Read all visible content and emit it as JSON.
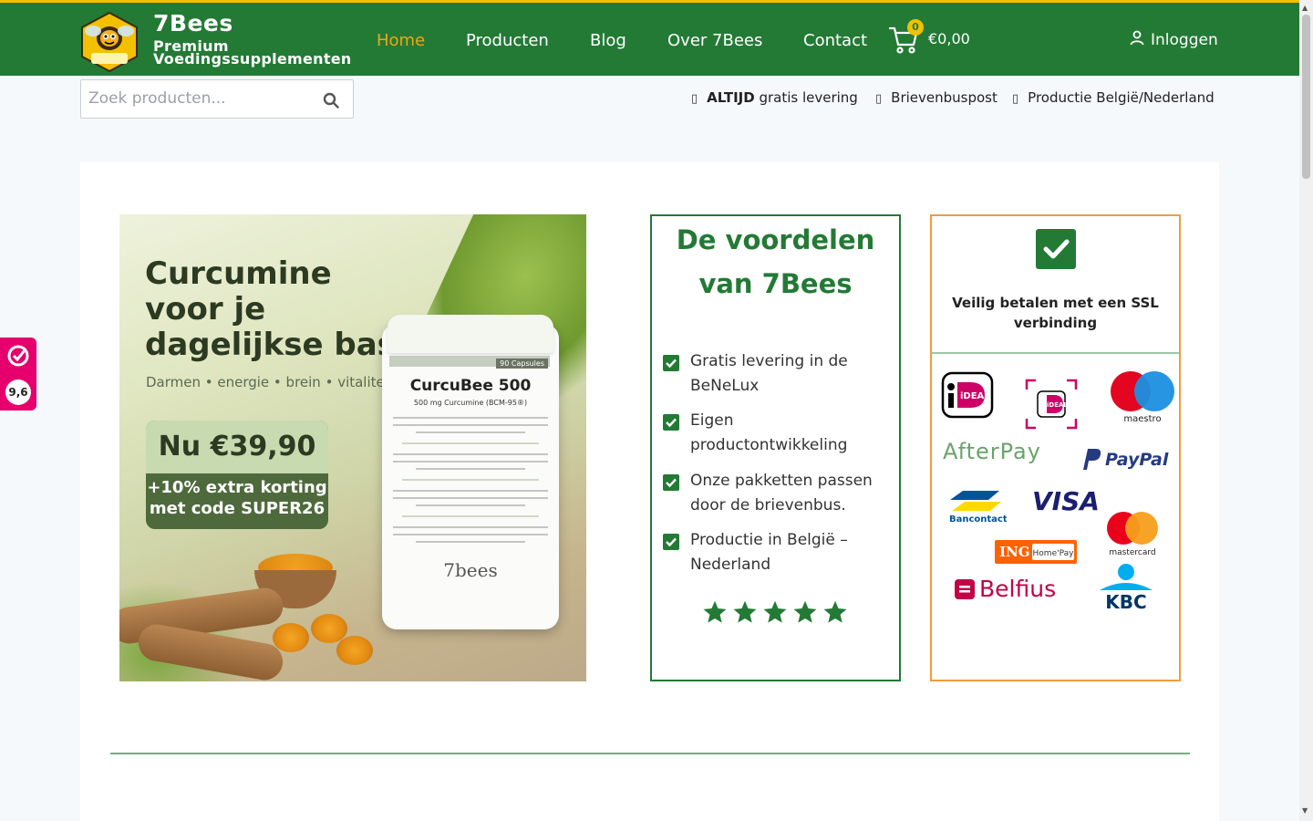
{
  "header": {
    "brand_name": "7Bees",
    "brand_tagline_1": "Premium",
    "brand_tagline_2": "Voedingssupplementen",
    "logo_label": "7Bees",
    "nav": [
      {
        "label": "Home",
        "active": true
      },
      {
        "label": "Producten",
        "active": false
      },
      {
        "label": "Blog",
        "active": false
      },
      {
        "label": "Over 7Bees",
        "active": false
      },
      {
        "label": "Contact",
        "active": false
      }
    ],
    "cart_count": "0",
    "cart_total": "€0,00",
    "login_label": "Inloggen"
  },
  "search": {
    "placeholder": "Zoek producten..."
  },
  "usps": [
    {
      "glyph": "▯",
      "bold": "ALTIJD",
      "text": " gratis levering"
    },
    {
      "glyph": "▯",
      "bold": "",
      "text": "Brievenbuspost"
    },
    {
      "glyph": "▯",
      "bold": "",
      "text": "Productie België/Nederland"
    }
  ],
  "promo": {
    "headline_1": "Curcumine",
    "headline_2": "voor je",
    "headline_3": "dagelijkse basis",
    "subline": "Darmen • energie • brein • vitaliteit",
    "price": "Nu €39,90",
    "discount_1": "+10% extra korting",
    "discount_2": "met code SUPER26",
    "product_name": "CurcuBee 500",
    "product_dose": "500 mg Curcumine (BCM-95®)",
    "capsules": "90 Capsules",
    "product_brand": "7bees"
  },
  "benefits": {
    "title": "De voordelen van 7Bees",
    "items": [
      "Gratis levering in de BeNeLux",
      "Eigen productontwikkeling",
      "Onze pakketten passen door de brievenbus.",
      "Productie in België – Nederland"
    ],
    "rating_stars": 5
  },
  "payments": {
    "title": "Veilig betalen met een SSL verbinding",
    "logos": {
      "ideal": "iDEAL",
      "ideal_qr": "iDEAL",
      "maestro": "maestro",
      "afterpay": "AfterPay",
      "paypal": "PayPal",
      "bancontact": "Bancontact",
      "visa": "VISA",
      "mastercard": "mastercard",
      "ing": "ING",
      "ing_homepay": "Home'Pay",
      "belfius": "Belfius",
      "kbc": "KBC"
    }
  },
  "review_badge": {
    "score": "9,6"
  },
  "colors": {
    "brand_green": "#237a35",
    "accent_yellow": "#f2c000",
    "nav_active": "#f2a418",
    "payments_border": "#f09c3b",
    "review_pink": "#e5006d"
  }
}
